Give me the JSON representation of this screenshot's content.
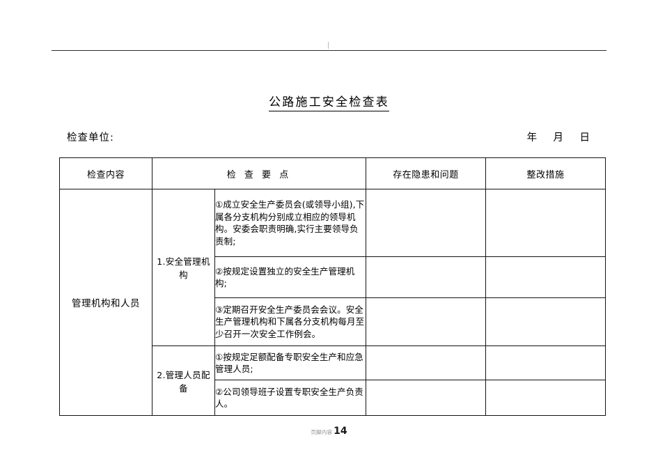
{
  "page": {
    "header_rule": true,
    "title": "公路施工安全检查表",
    "meta": {
      "unit_label": "检查单位:",
      "date_label": "年    月    日"
    },
    "footer": {
      "watermark": "页脚内容",
      "page_number": "14"
    }
  },
  "table": {
    "headers": {
      "content": "检查内容",
      "points": "检 查 要 点",
      "issues": "存在隐患和问题",
      "measures": "整改措施"
    },
    "group": {
      "label": "管理机构和人员"
    },
    "items": [
      {
        "label": "1.安全管理机构",
        "points": [
          "①成立安全生产委员会(或领导小组),下属各分支机构分别成立相应的领导机构。安委会职责明确,实行主要领导负责制;",
          "②按规定设置独立的安全生产管理机构;",
          "③定期召开安全生产委员会会议。安全生产管理机构和下属各分支机构每月至少召开一次安全工作例会。"
        ]
      },
      {
        "label": "2.管理人员配备",
        "points": [
          "①按规定足额配备专职安全生产和应急管理人员;",
          "②公司领导班子设置专职安全生产负责人。"
        ]
      }
    ],
    "issues_values": [
      "",
      "",
      "",
      "",
      ""
    ],
    "measures_values": [
      "",
      "",
      "",
      "",
      ""
    ]
  }
}
